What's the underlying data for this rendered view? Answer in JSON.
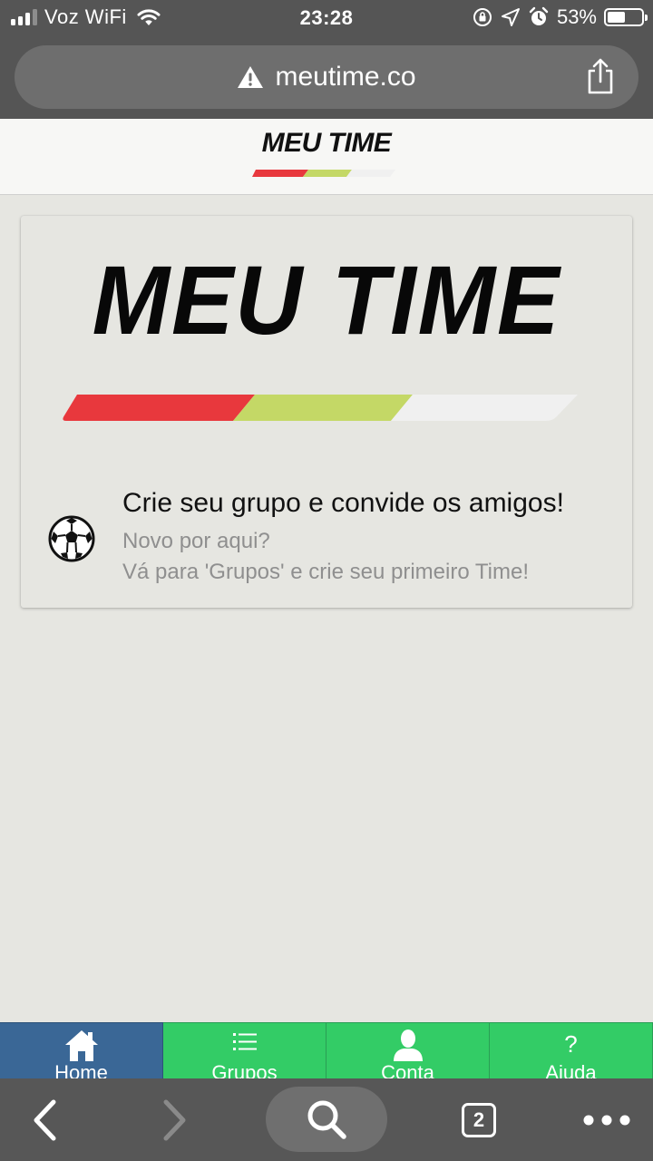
{
  "status_bar": {
    "carrier": "Voz WiFi",
    "time": "23:28",
    "battery_percent": "53%",
    "battery_level": 0.53
  },
  "browser": {
    "url": "meutime.co",
    "url_warning_icon": "warning-triangle-icon",
    "tab_count": "2"
  },
  "header": {
    "logo_text": "MEU TIME"
  },
  "card": {
    "logo_text": "MEU TIME",
    "title": "Crie seu grupo e convide os amigos!",
    "line1": "Novo por aqui?",
    "line2": "Vá para 'Grupos' e crie seu primeiro Time!"
  },
  "nav": {
    "tabs": [
      {
        "label": "Home",
        "icon": "home-icon",
        "active": true
      },
      {
        "label": "Grupos",
        "icon": "list-icon",
        "active": false
      },
      {
        "label": "Conta",
        "icon": "user-icon",
        "active": false
      },
      {
        "label": "Ajuda",
        "icon": "question-icon",
        "active": false
      }
    ]
  },
  "colors": {
    "stripe_red": "#e8383d",
    "stripe_green": "#c4d866",
    "stripe_white": "#f0f0f0",
    "nav_active": "#3a6796",
    "nav_green": "#33cc66"
  }
}
